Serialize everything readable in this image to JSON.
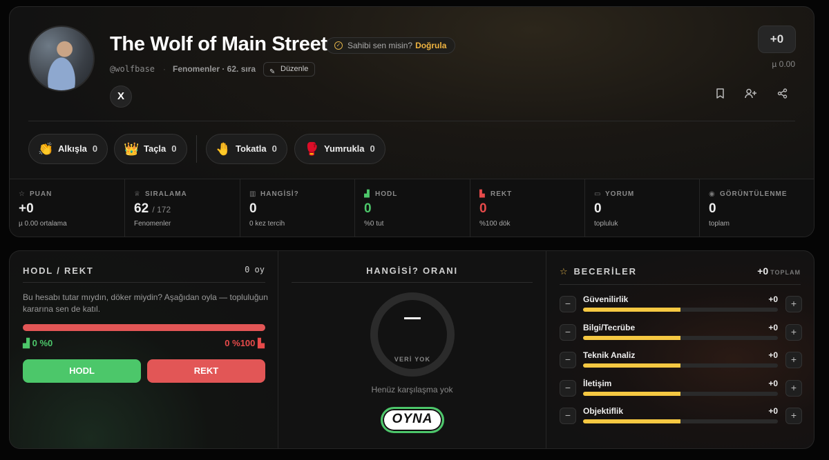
{
  "profile": {
    "name": "The Wolf of Main Street",
    "claim_text": "Sahibi sen misin?",
    "claim_link": "Doğrula",
    "handle": "@wolfbase",
    "rank_text": "Fenomenler · 62. sıra",
    "edit_label": "Düzenle",
    "score": "+0",
    "score_avg": "µ 0.00",
    "social": "X"
  },
  "reactions": [
    {
      "label": "Alkışla",
      "count": "0",
      "icon": "clap-icon"
    },
    {
      "label": "Taçla",
      "count": "0",
      "icon": "crown-icon"
    },
    {
      "label": "Tokatla",
      "count": "0",
      "icon": "slap-icon"
    },
    {
      "label": "Yumrukla",
      "count": "0",
      "icon": "punch-icon"
    }
  ],
  "stats": [
    {
      "label": "PUAN",
      "value": "+0",
      "sub": "µ 0.00 ortalama",
      "icon": "star-icon"
    },
    {
      "label": "SIRALAMA",
      "value": "62",
      "value_extra": "/ 172",
      "sub": "Fenomenler",
      "icon": "trophy-icon"
    },
    {
      "label": "HANGİSİ?",
      "value": "0",
      "sub": "0 kez tercih",
      "icon": "bar-chart-icon"
    },
    {
      "label": "HODL",
      "value": "0",
      "sub": "%0 tut",
      "icon": "hodl-icon"
    },
    {
      "label": "REKT",
      "value": "0",
      "sub": "%100 dök",
      "icon": "rekt-icon"
    },
    {
      "label": "YORUM",
      "value": "0",
      "sub": "topluluk",
      "icon": "comment-icon"
    },
    {
      "label": "GÖRÜNTÜLENME",
      "value": "0",
      "sub": "toplam",
      "icon": "eye-icon"
    }
  ],
  "hodl": {
    "title": "HODL / REKT",
    "votes": "0 oy",
    "description": "Bu hesabı tutar mıydın, döker miydin? Aşağıdan oyla — topluluğun kararına sen de katıl.",
    "hodl_pct": "0 %0",
    "rekt_pct": "0 %100",
    "hodl_fraction": 0,
    "hodl_button": "HODL",
    "rekt_button": "REKT",
    "colors": {
      "hodl": "#4cc76a",
      "rekt": "#e25656"
    }
  },
  "hangisi": {
    "title": "HANGİSİ? ORANI",
    "ring_value": "—",
    "ring_caption": "VERİ YOK",
    "no_match": "Henüz karşılaşma yok",
    "play_button": "OYNA"
  },
  "skills": {
    "title": "BECERİLER",
    "total": "+0",
    "total_label": "TOPLAM",
    "items": [
      {
        "name": "Güvenilirlik",
        "value": "+0",
        "level": 0.5
      },
      {
        "name": "Bilgi/Tecrübe",
        "value": "+0",
        "level": 0.5
      },
      {
        "name": "Teknik Analiz",
        "value": "+0",
        "level": 0.5
      },
      {
        "name": "İletişim",
        "value": "+0",
        "level": 0.5
      },
      {
        "name": "Objektiflik",
        "value": "+0",
        "level": 0.5
      }
    ],
    "minus_label": "−",
    "plus_label": "+"
  }
}
